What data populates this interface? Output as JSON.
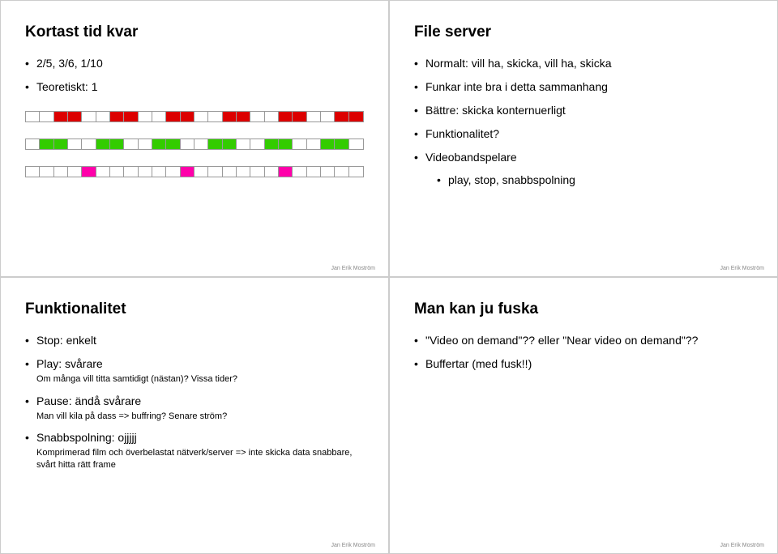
{
  "topLeft": {
    "title": "Kortast tid kvar",
    "items": [
      "2/5, 3/6, 1/10",
      "Teoretiskt: 1"
    ],
    "footer": "Jan Erik Moström"
  },
  "topRight": {
    "title": "File server",
    "items": [
      "Normalt: vill ha, skicka, vill ha, skicka",
      "Funkar inte bra i detta sammanhang",
      "Bättre: skicka konternuerligt",
      "Funktionalitet?"
    ],
    "subParent": "Videobandspelare",
    "subItem": "play, stop, snabbspolning",
    "footer": "Jan Erik Moström"
  },
  "bottomLeft": {
    "title": "Funktionalitet",
    "items": [
      {
        "main": "Stop: enkelt"
      },
      {
        "main": "Play: svårare",
        "sub": "Om många vill titta samtidigt (nästan)? Vissa tider?"
      },
      {
        "main": "Pause: ändå svårare",
        "sub": "Man vill kila på dass => buffring? Senare ström?"
      },
      {
        "main": "Snabbspolning: ojjjjj",
        "sub": "Komprimerad film och överbelastat nätverk/server => inte skicka data snabbare, svårt hitta rätt frame"
      }
    ],
    "footer": "Jan Erik Moström"
  },
  "bottomRight": {
    "title": "Man kan ju fuska",
    "items": [
      "\"Video on demand\"?? eller \"Near video on demand\"??",
      "Buffertar (med fusk!!)"
    ],
    "footer": "Jan Erik Moström"
  },
  "chart_data": [
    {
      "type": "bar",
      "row": "red",
      "cells": 24,
      "filled": [
        2,
        3,
        6,
        7,
        10,
        11,
        14,
        15,
        18,
        19,
        22,
        23
      ],
      "color": "#dc0000"
    },
    {
      "type": "bar",
      "row": "green",
      "cells": 24,
      "filled": [
        1,
        2,
        5,
        6,
        9,
        10,
        13,
        14,
        17,
        18,
        21,
        22
      ],
      "color": "#33cc00"
    },
    {
      "type": "bar",
      "row": "pink",
      "cells": 24,
      "filled": [
        4,
        11,
        18
      ],
      "color": "#ff00aa"
    }
  ]
}
